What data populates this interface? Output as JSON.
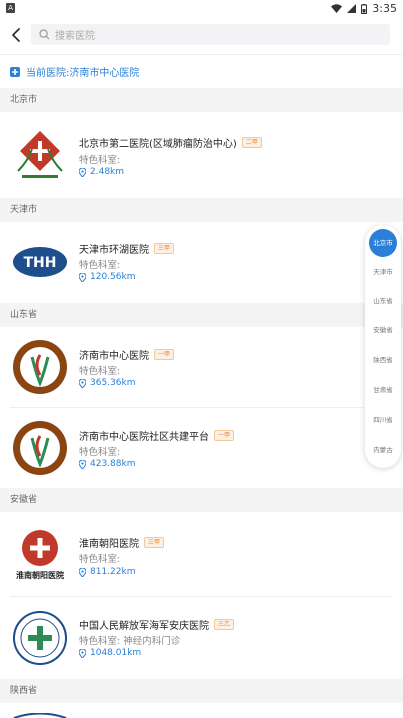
{
  "status_bar": {
    "time": "3:35",
    "left_badge": "A"
  },
  "search": {
    "placeholder": "搜索医院"
  },
  "current_hospital": "当前医院:济南市中心医院",
  "sections": [
    {
      "title": "北京市"
    },
    {
      "title": "天津市"
    },
    {
      "title": "山东省"
    },
    {
      "title": "安徽省"
    },
    {
      "title": "陕西省"
    }
  ],
  "hospitals": [
    {
      "name": "北京市第二医院(区域肺瘤防治中心)",
      "grade": "二甲",
      "dept": "特色科室:",
      "distance": "2.48km",
      "logo": "cross-logo"
    },
    {
      "name": "天津市环湖医院",
      "grade": "三甲",
      "dept": "特色科室:",
      "distance": "120.56km",
      "logo": "thh-logo"
    },
    {
      "name": "济南市中心医院",
      "grade": "一甲",
      "dept": "特色科室:",
      "distance": "365.36km",
      "logo": "jinan-central-logo"
    },
    {
      "name": "济南市中心医院社区共建平台",
      "grade": "一甲",
      "dept": "特色科室:",
      "distance": "423.88km",
      "logo": "jinan-central-logo"
    },
    {
      "name": "淮南朝阳医院",
      "grade": "三甲",
      "dept": "特色科室:",
      "distance": "811.22km",
      "logo": "huainan-logo"
    },
    {
      "name": "中国人民解放军海军安庆医院",
      "grade": "三乙",
      "dept": "特色科室:  神经内科门诊",
      "distance": "1048.01km",
      "logo": "navy-logo"
    }
  ],
  "logo_text": {
    "thh": "THH",
    "huainan": "淮南朝阳医院"
  },
  "side_index": [
    "北京市",
    "天津市",
    "山东省",
    "安徽省",
    "陕西省",
    "甘肃省",
    "四川省",
    "内蒙古"
  ],
  "colors": {
    "accent": "#2a7fd6",
    "grade_text": "#e08a3c",
    "section_bg": "#f4f4f4"
  }
}
